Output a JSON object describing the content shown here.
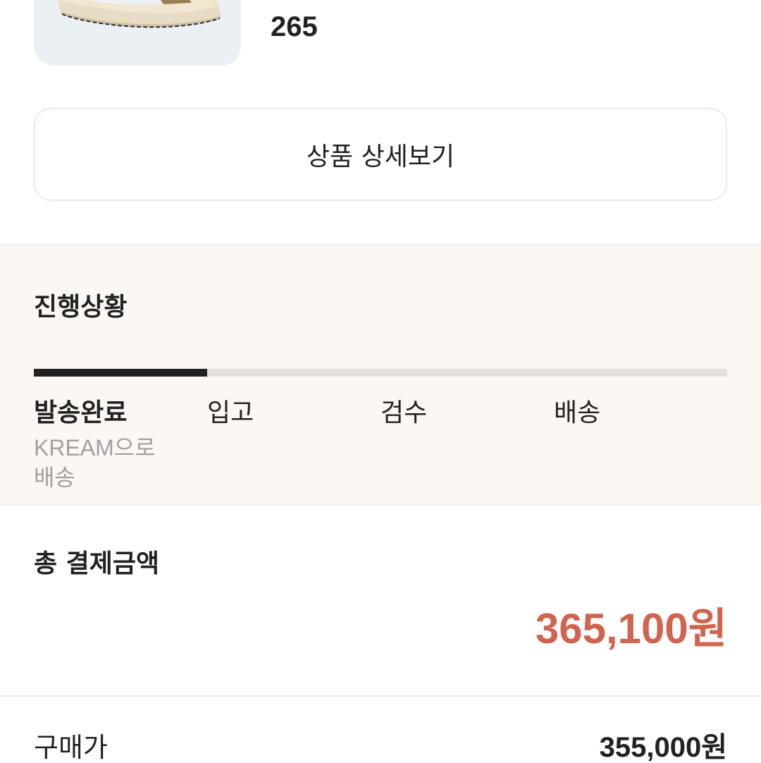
{
  "product": {
    "image_icon": "sneaker-image",
    "size": "265",
    "detail_button_label": "상품 상세보기"
  },
  "progress": {
    "title": "진행상황",
    "completed_fraction": 0.25,
    "steps": [
      {
        "label": "발송완료",
        "description": "KREAM으로 배송",
        "active": true
      },
      {
        "label": "입고",
        "description": "",
        "active": false
      },
      {
        "label": "검수",
        "description": "",
        "active": false
      },
      {
        "label": "배송",
        "description": "",
        "active": false
      }
    ]
  },
  "total": {
    "title": "총 결제금액",
    "amount": "365,100원"
  },
  "breakdown": {
    "purchase_price_label": "구매가",
    "purchase_price_value": "355,000원"
  },
  "colors": {
    "accent_price": "#d06450",
    "progress_background": "#fdf7f4",
    "progress_fill": "#222222"
  }
}
